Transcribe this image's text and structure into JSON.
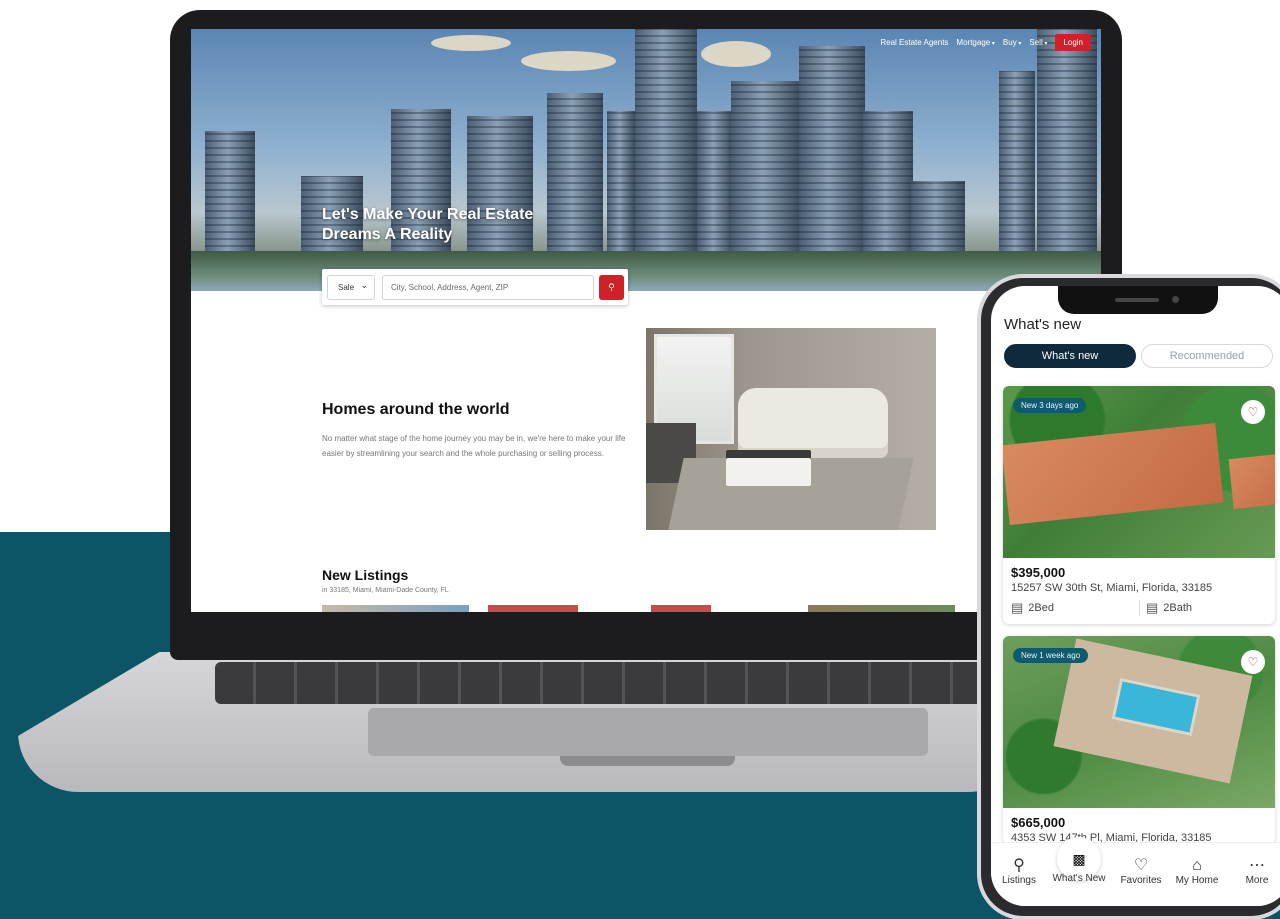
{
  "website": {
    "nav": {
      "agents": "Real Estate Agents",
      "mortgage": "Mortgage",
      "buy": "Buy",
      "sell": "Sell",
      "login": "Login"
    },
    "hero": {
      "title": "Let's Make Your Real Estate Dreams A Reality"
    },
    "search": {
      "type_value": "Sale",
      "placeholder": "City, School, Address, Agent, ZIP",
      "button_icon": "search-icon"
    },
    "homes": {
      "title": "Homes around the world",
      "description": "No matter what stage of the home journey you may be in, we're here to make your life easier by streamlining your search and the whole purchasing or selling process."
    },
    "listings": {
      "title": "New Listings",
      "subtitle": "in 33185, Miami, Miami-Dade County, FL"
    }
  },
  "app": {
    "title": "What's new",
    "tabs": [
      {
        "label": "What's new",
        "active": true
      },
      {
        "label": "Recommended",
        "active": false
      }
    ],
    "cards": [
      {
        "badge": "New 3 days ago",
        "price": "$395,000",
        "address": "15257 SW 30th St, Miami, Florida, 33185",
        "beds": "2Bed",
        "baths": "2Bath"
      },
      {
        "badge": "New 1 week ago",
        "price": "$665,000",
        "address": "4353 SW 147th Pl, Miami, Florida, 33185"
      }
    ],
    "tabbar": [
      {
        "label": "Listings",
        "icon": "search-pin-icon"
      },
      {
        "label": "What's New",
        "icon": "news-icon"
      },
      {
        "label": "Favorites",
        "icon": "heart-icon"
      },
      {
        "label": "My Home",
        "icon": "home-icon"
      },
      {
        "label": "More",
        "icon": "more-icon"
      }
    ]
  },
  "colors": {
    "brand_red": "#cf2127",
    "teal": "#0b5567",
    "navy": "#0f2a3d"
  }
}
